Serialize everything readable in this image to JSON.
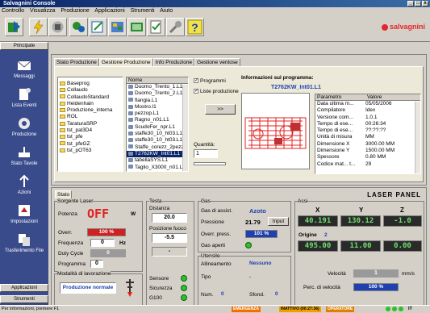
{
  "window": {
    "title": "Salvagnini Console"
  },
  "menu": [
    "Controllo",
    "Visualizza",
    "Produzione",
    "Applicazioni",
    "Strumenti",
    "Aiuto"
  ],
  "brand": "salvagnini",
  "sidebar": {
    "top": "Principale",
    "items": [
      {
        "label": "Messaggi",
        "icon": "envelope-icon"
      },
      {
        "label": "Lista Eventi",
        "icon": "event-list-icon"
      },
      {
        "label": "Produzione",
        "icon": "production-icon"
      },
      {
        "label": "Stato Tavole",
        "icon": "tables-icon"
      },
      {
        "label": "Azioni",
        "icon": "actions-icon"
      },
      {
        "label": "Impostazioni",
        "icon": "settings-icon"
      },
      {
        "label": "Trasferimento File",
        "icon": "file-transfer-icon"
      }
    ],
    "bottom1": "Applicazioni",
    "bottom2": "Strumenti"
  },
  "tabs": [
    "Stato Produzione",
    "Gestione Produzione",
    "Info Produzione",
    "Gestione ventose"
  ],
  "folders": [
    "Baseprog",
    "Collaudo",
    "CollaudoStandard",
    "Heidenhain",
    "Produzione_interna",
    "ROL",
    "TaraturaSRP",
    "tst_pal3D4",
    "tst_pfe",
    "tst_pfeGZ",
    "tst_pOT63"
  ],
  "files": {
    "header": "Nome",
    "items": [
      "Duomo_Trento_1.L1",
      "Duomo_Trento_2.L1",
      "flangia.L1",
      "Mostro.l1",
      "pezzop.L1",
      "Ragno_n01.L1",
      "ScudoFer_npr.L1",
      "staffe30_10_ht03.L1",
      "staffe30_10_ht03.L1",
      "Staffe_corezz_2pezz",
      "T2762KW_Int01.L1",
      "tabellaSYS.L1",
      "Taglio_X3000_n01.L1"
    ],
    "selected": 10
  },
  "options": {
    "programmi": "Programmi",
    "liste": "Liste produzione",
    "button": ">>",
    "quantita_label": "Quantità:",
    "quantita": "1"
  },
  "info": {
    "title": "Informazioni sul programma:",
    "program": "T2762KW_Int01.L1",
    "col1": "Parametro",
    "col2": "Valore",
    "rows": [
      [
        "Data ultima m...",
        "05/05/2006"
      ],
      [
        "Compilatore",
        "Idex"
      ],
      [
        "Versione com...",
        "1.0.1"
      ],
      [
        "Tempo di ese...",
        "00:26:34"
      ],
      [
        "Tempo di ese...",
        "??:??:??"
      ],
      [
        "Unità di misura",
        "MM"
      ],
      [
        "Dimensione X",
        "3000.00 MM"
      ],
      [
        "Dimensione Y",
        "1500.00 MM"
      ],
      [
        "Spessore",
        "0.80 MM"
      ],
      [
        "Codice mat... t...",
        "29"
      ]
    ]
  },
  "stato": {
    "tab": "Stato",
    "panel_title": "LASER PANEL",
    "sorgente": {
      "title": "Sorgente Laser",
      "potenza_label": "Potenza",
      "potenza_state": "OFF",
      "potenza_unit": "W",
      "overr_label": "Overr.",
      "overr_value": "100 %",
      "overr_pct": 100,
      "freq_label": "Frequenza",
      "freq_value": "0",
      "freq_unit": "Hz",
      "duty_label": "Duty Cycle",
      "duty_value": "0",
      "prog_label": "Programma",
      "prog_value": "0",
      "modalita_label": "Modalità di lavorazione",
      "modalita_value": "Produzione normale"
    },
    "testa": {
      "title": "Testa",
      "distanza_label": "Distanza",
      "distanza_value": "20.0",
      "posizione_label": "Posizione fuoco",
      "posizione_value": "-5.5",
      "extra": "-",
      "sensore": "Sensore",
      "sicurezza": "Sicurezza",
      "g100": "G100"
    },
    "gas": {
      "title": "Gas",
      "assist_label": "Gas di assist.",
      "assist_value": "Azoto",
      "press_label": "Pressione",
      "press_value": "21.79",
      "input": "Input",
      "overr_label": "Overr. press.",
      "overr_value": "101 %",
      "overr_pct": 100,
      "aperti": "Gas aperti"
    },
    "utensile": {
      "title": "Utensile",
      "allin_label": "Allineamento",
      "allin_value": "Nessuno",
      "tipo_label": "Tipo",
      "tipo_value": "-",
      "num_label": "Num.",
      "num_value": "0",
      "sfond_label": "Sfond.",
      "sfond_value": "0"
    },
    "assi": {
      "title": "Assi",
      "x": "X",
      "y": "Y",
      "z": "Z",
      "pos": [
        "40.191",
        "130.12",
        "-1.0"
      ],
      "origine_label": "Origine",
      "origine_value": "2",
      "ori": [
        "495.00",
        "11.00",
        "0.00"
      ],
      "vel_label": "Velocità",
      "vel_value": "1",
      "vel_unit": "mm/s",
      "perc_label": "Perc. di velocità",
      "perc_value": "100 %",
      "perc_pct": 100
    }
  },
  "status": {
    "hint": "Per informazioni, premere F1",
    "emergenza": "EMERGENZA",
    "inattivo": "INATTIVO (00:27:36)",
    "operatore": "OPERATORE",
    "lang": "IT"
  }
}
